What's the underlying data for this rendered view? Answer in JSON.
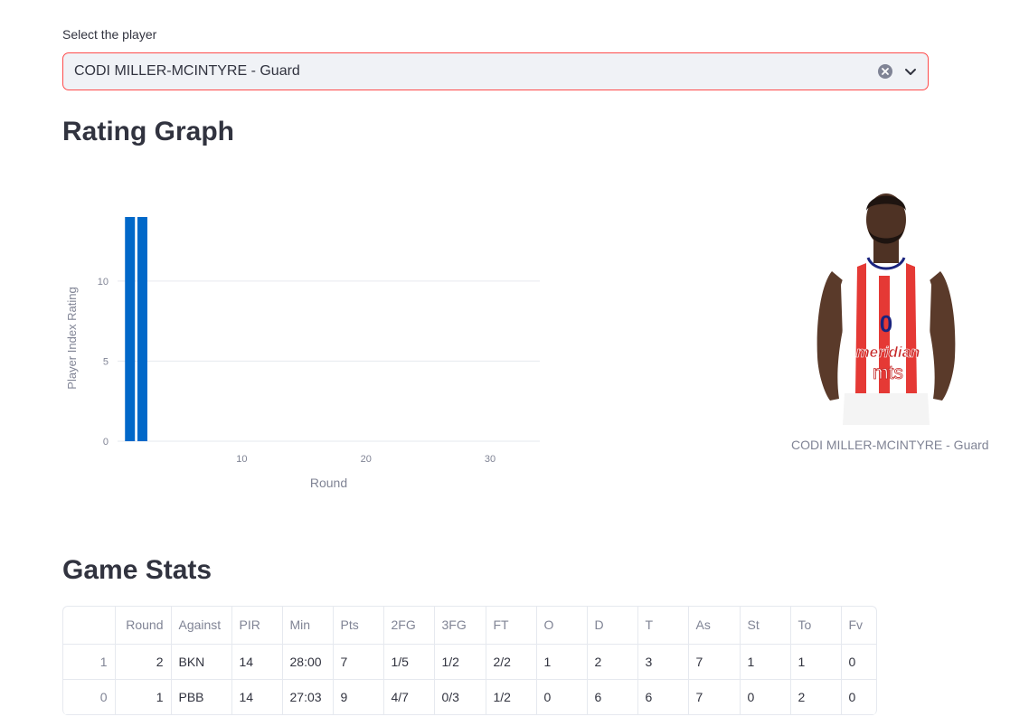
{
  "selector": {
    "label": "Select the player",
    "value": "CODI MILLER-MCINTYRE - Guard",
    "clear_icon": "clear-circle-icon",
    "chevron_icon": "chevron-down-icon",
    "accent_color": "#ff4b4b"
  },
  "rating_section": {
    "title": "Rating Graph"
  },
  "chart_data": {
    "type": "bar",
    "x": [
      1,
      2
    ],
    "values": [
      14,
      14
    ],
    "xlabel": "Round",
    "ylabel": "Player Index Rating",
    "xlim": [
      0,
      34
    ],
    "ylim": [
      0,
      14
    ],
    "xticks": [
      10,
      20,
      30
    ],
    "yticks": [
      0,
      5,
      10
    ],
    "grid": true,
    "bar_color": "#0068c9"
  },
  "player": {
    "caption": "CODI MILLER-MCINTYRE - Guard",
    "jersey_number": "0",
    "sponsor_1": "meridian",
    "sponsor_2": "mts"
  },
  "stats_section": {
    "title": "Game Stats",
    "columns": [
      "",
      "Round",
      "Against",
      "PIR",
      "Min",
      "Pts",
      "2FG",
      "3FG",
      "FT",
      "O",
      "D",
      "T",
      "As",
      "St",
      "To",
      "Fv"
    ],
    "rows": [
      [
        "1",
        "2",
        "BKN",
        "14",
        "28:00",
        "7",
        "1/5",
        "1/2",
        "2/2",
        "1",
        "2",
        "3",
        "7",
        "1",
        "1",
        "0"
      ],
      [
        "0",
        "1",
        "PBB",
        "14",
        "27:03",
        "9",
        "4/7",
        "0/3",
        "1/2",
        "0",
        "6",
        "6",
        "7",
        "0",
        "2",
        "0"
      ]
    ]
  }
}
